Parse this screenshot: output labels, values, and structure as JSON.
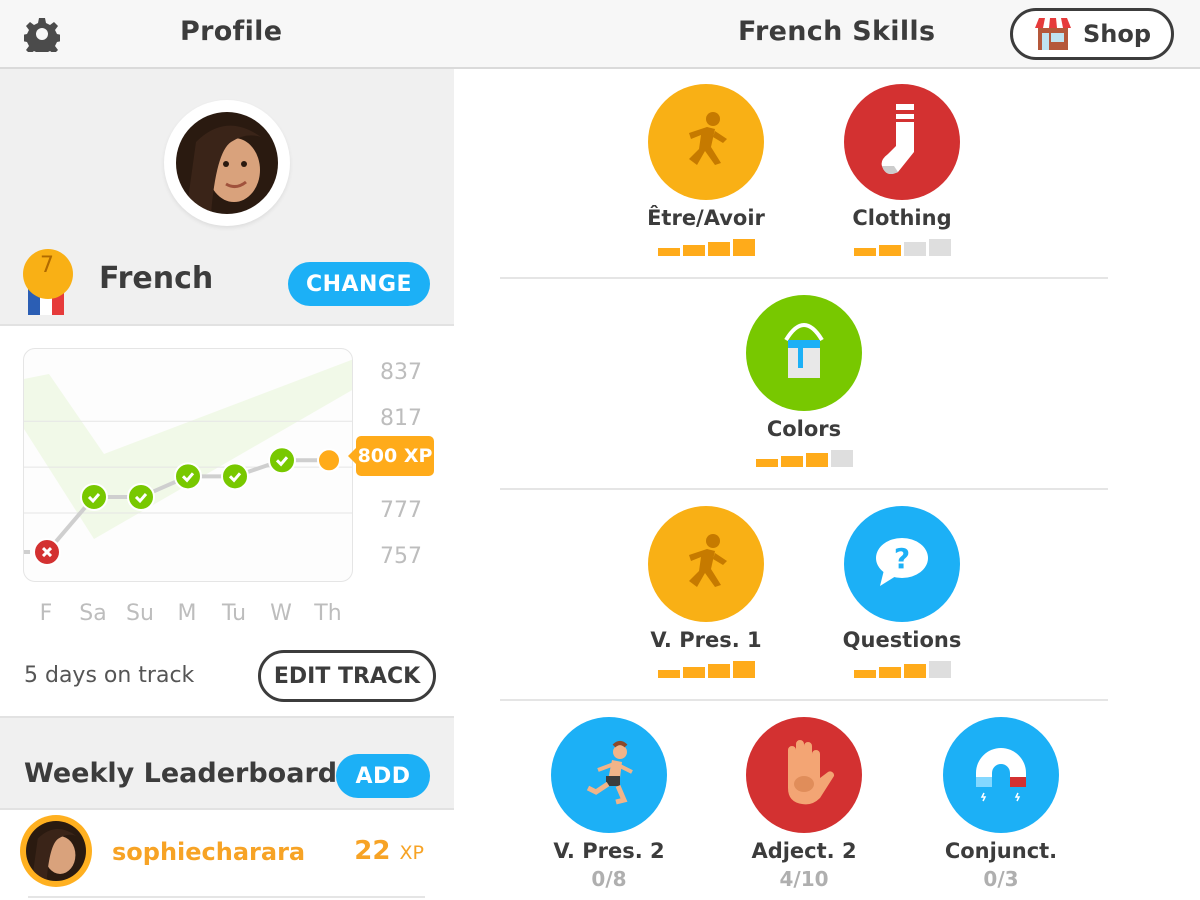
{
  "profile_header": {
    "title": "Profile",
    "settings_icon": "gear-icon"
  },
  "skills_header": {
    "title": "French Skills",
    "shop_label": "Shop",
    "shop_icon": "storefront-icon"
  },
  "language": {
    "name": "French",
    "level": "7",
    "change_label": "CHANGE",
    "flag_colors": [
      "#2b5eb4",
      "#ffffff",
      "#e63b3b"
    ]
  },
  "chart_data": {
    "type": "line",
    "title": "",
    "categories": [
      "F",
      "Sa",
      "Su",
      "M",
      "Tu",
      "W",
      "Th"
    ],
    "y_ticks": [
      837,
      817,
      777,
      757
    ],
    "ylim": [
      750,
      845
    ],
    "series": [
      {
        "name": "XP",
        "values": [
          760,
          784,
          784,
          793,
          793,
          800,
          800
        ]
      }
    ],
    "day_status": [
      "missed",
      "done",
      "done",
      "done",
      "done",
      "done",
      "today"
    ],
    "current_label": "800 XP",
    "grid": true
  },
  "track": {
    "status": "5 days on track",
    "edit_label": "EDIT TRACK"
  },
  "leaderboard": {
    "title": "Weekly Leaderboard",
    "add_label": "ADD",
    "entries": [
      {
        "username": "sophiecharara",
        "xp": "22",
        "xp_unit": "XP"
      }
    ]
  },
  "colors": {
    "blue": "#1cb0f6",
    "orange": "#ffab1a",
    "green": "#78c800",
    "red": "#d33131",
    "gray_bar": "#dedede"
  },
  "skills": [
    {
      "name": "Être/Avoir",
      "icon": "running-man-icon",
      "color": "#f9b015",
      "strength": 4,
      "max": 4
    },
    {
      "name": "Clothing",
      "icon": "sock-icon",
      "color": "#d33131",
      "strength": 2,
      "max": 4
    },
    {
      "name": "Colors",
      "icon": "paint-bucket-icon",
      "color": "#78c800",
      "strength": 3,
      "max": 4
    },
    {
      "name": "V. Pres. 1",
      "icon": "running-man-icon",
      "color": "#f9b015",
      "strength": 4,
      "max": 4
    },
    {
      "name": "Questions",
      "icon": "question-bubble-icon",
      "color": "#1cb0f6",
      "strength": 3,
      "max": 4
    },
    {
      "name": "V. Pres. 2",
      "icon": "runner-icon",
      "color": "#1cb0f6",
      "progress": "0/8"
    },
    {
      "name": "Adject. 2",
      "icon": "hand-icon",
      "color": "#d33131",
      "progress": "4/10"
    },
    {
      "name": "Conjunct.",
      "icon": "magnet-icon",
      "color": "#1cb0f6",
      "progress": "0/3"
    }
  ]
}
